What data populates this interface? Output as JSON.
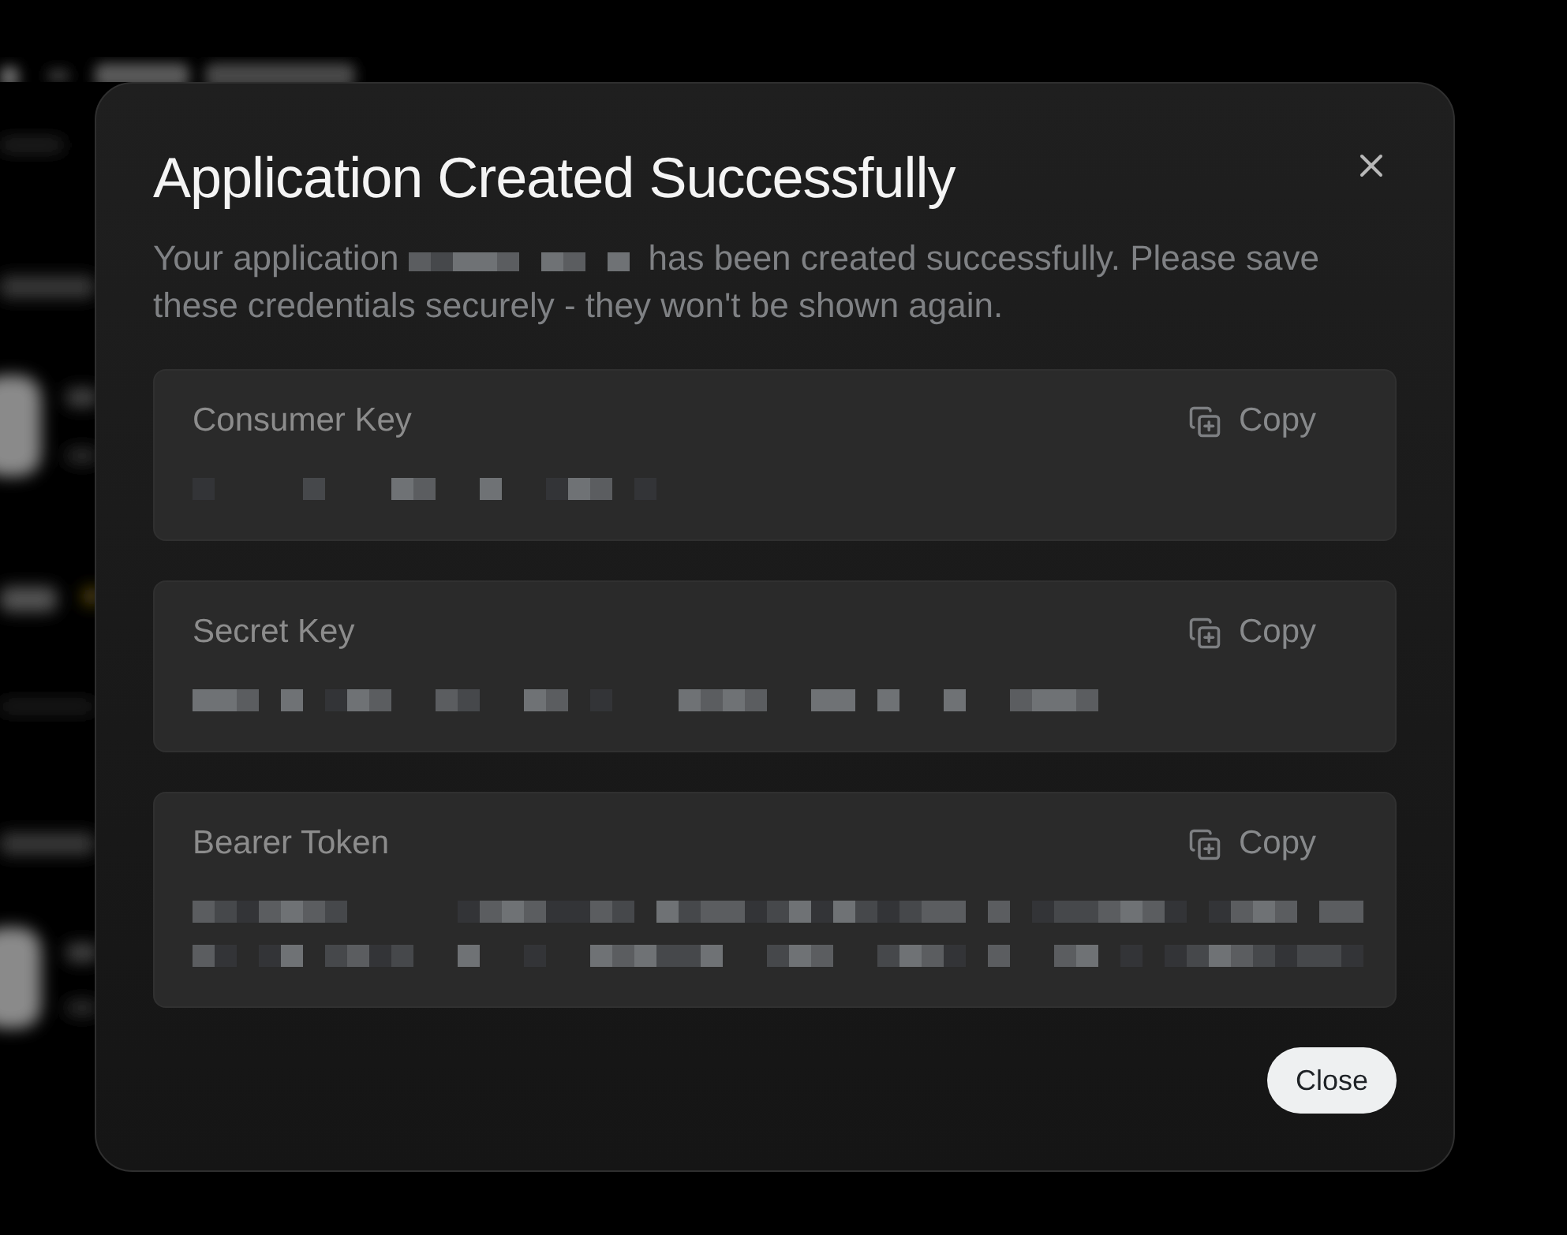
{
  "dialog": {
    "title": "Application Created Successfully",
    "description": {
      "before": "Your application",
      "after": "has been created successfully. Please save these credentials securely - they won't be shown again."
    },
    "credentials": [
      {
        "label": "Consumer Key",
        "copy_button": "Copy"
      },
      {
        "label": "Secret Key",
        "copy_button": "Copy"
      },
      {
        "label": "Bearer Token",
        "copy_button": "Copy"
      }
    ],
    "close_button": "Close"
  }
}
